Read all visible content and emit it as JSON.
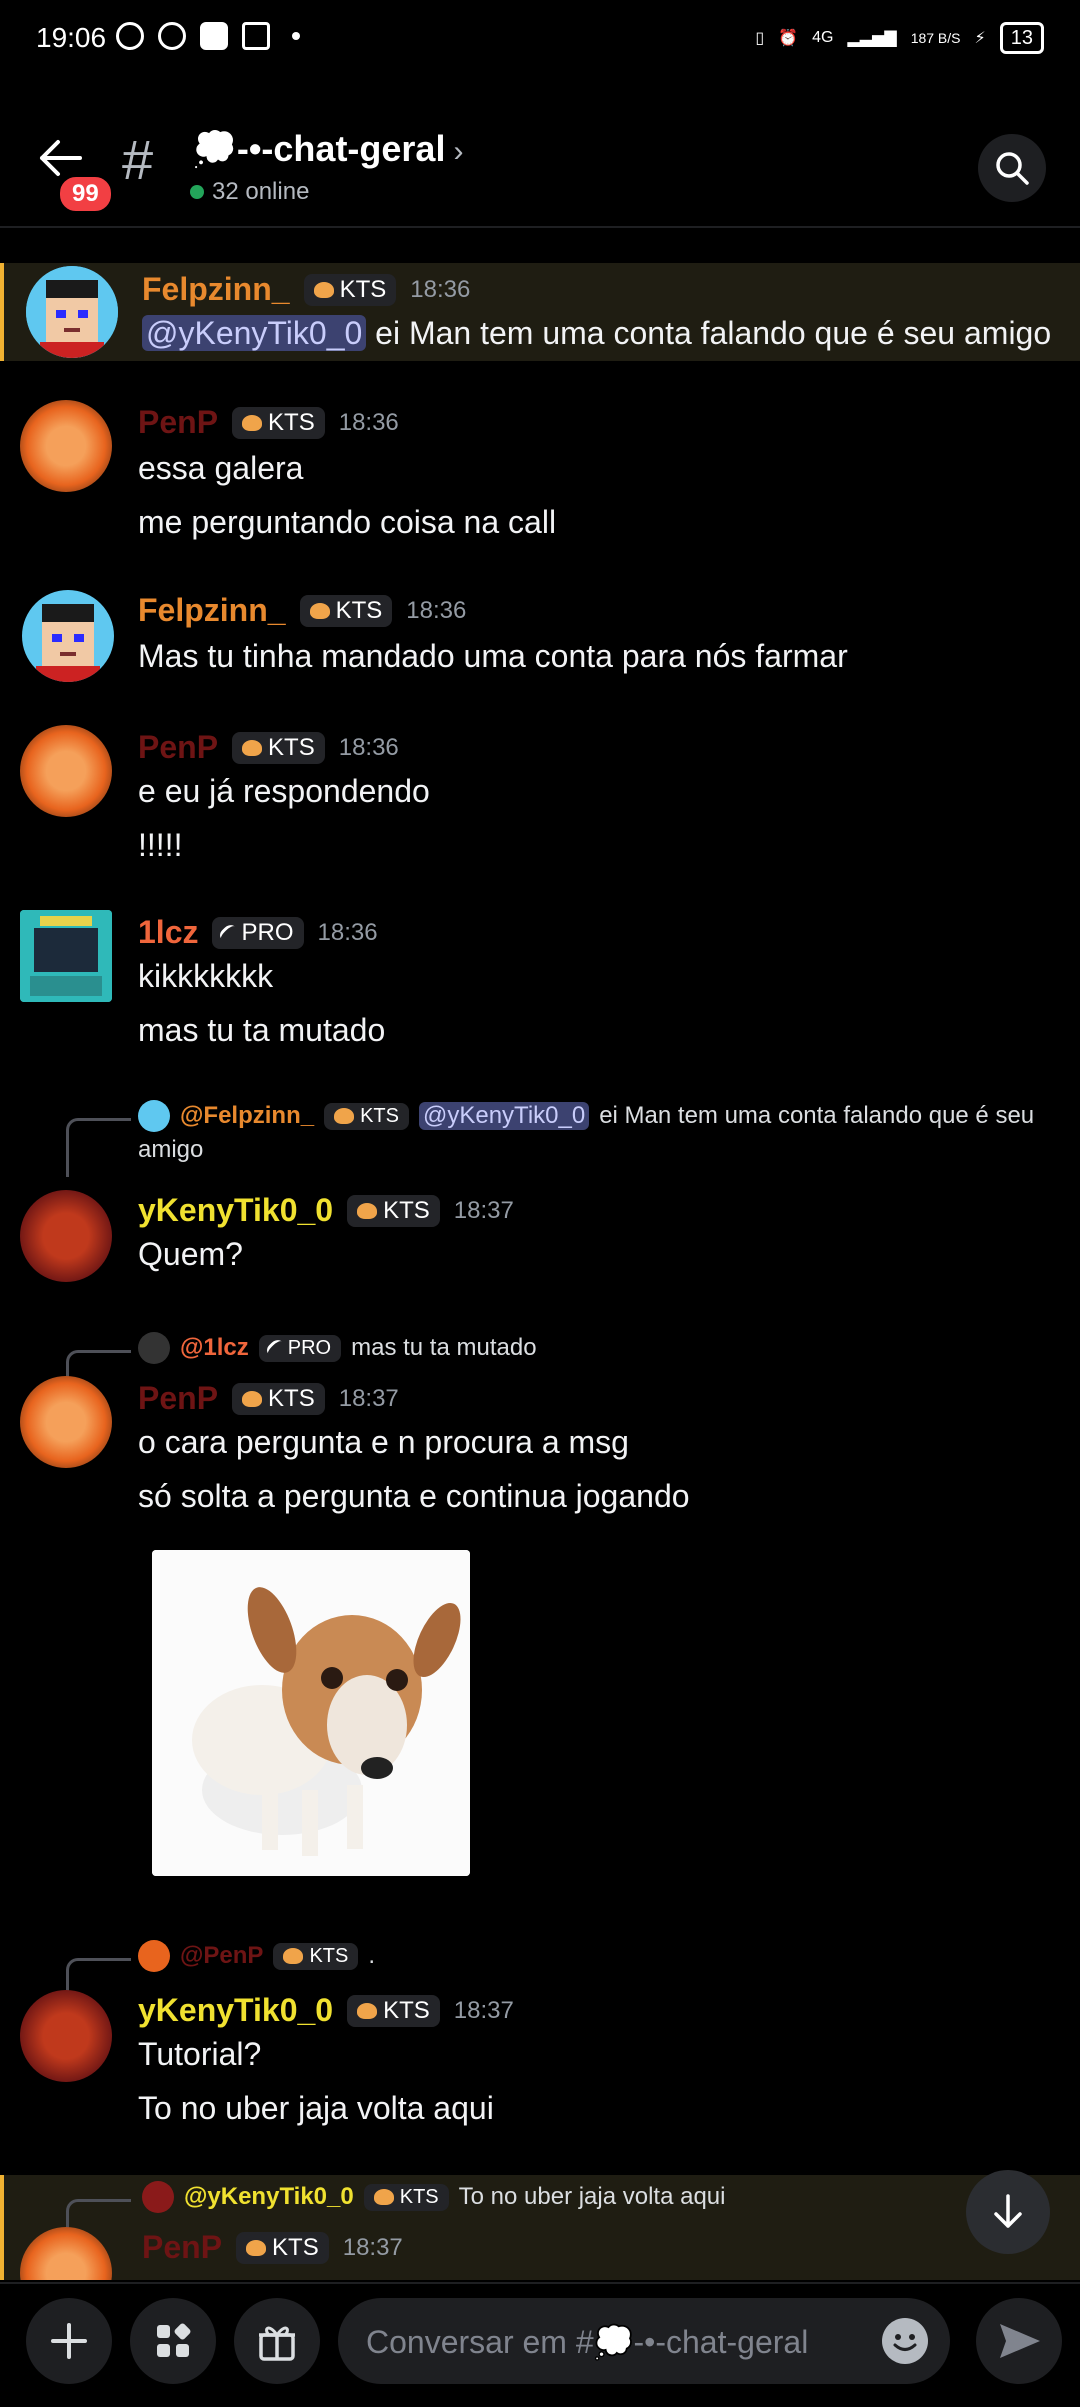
{
  "status_bar": {
    "time": "19:06",
    "network": "4G",
    "speed": "187 B/S",
    "battery": "13"
  },
  "header": {
    "badge": "99",
    "channel_name": "💭-•-chat-geral",
    "online": "32 online"
  },
  "colors": {
    "mention_bg": "#3c4270",
    "online": "#23a55a",
    "badge": "#f23f43",
    "highlight": "#f0b232"
  },
  "messages": [
    {
      "user": "Felpzinn_",
      "user_color": "#e8892e",
      "tag": "KTS",
      "time": "18:36",
      "mention": "@yKenyTik0_0",
      "text_after": " ei Man tem uma conta falando que é seu amigo"
    },
    {
      "user": "PenP",
      "user_color": "#6e1414",
      "tag": "KTS",
      "time": "18:36",
      "lines": [
        "essa galera",
        "me perguntando coisa na call"
      ]
    },
    {
      "user": "Felpzinn_",
      "user_color": "#e8892e",
      "tag": "KTS",
      "time": "18:36",
      "lines": [
        "Mas tu tinha mandado uma conta para nós farmar"
      ]
    },
    {
      "user": "PenP",
      "user_color": "#6e1414",
      "tag": "KTS",
      "time": "18:36",
      "lines": [
        "e eu já respondendo",
        "!!!!!"
      ]
    },
    {
      "user": "1lcz",
      "user_color": "#f0663c",
      "tag": "PRO",
      "time": "18:36",
      "lines": [
        "kikkkkkkk",
        "mas tu ta mutado"
      ]
    },
    {
      "reply": {
        "user": "@Felpzinn_",
        "tag": "KTS",
        "mention": "@yKenyTik0_0",
        "text": "ei Man tem uma conta falando que é seu",
        "text2": "amigo"
      },
      "user": "yKenyTik0_0",
      "user_color": "#f0e130",
      "tag": "KTS",
      "time": "18:37",
      "lines": [
        "Quem?"
      ]
    },
    {
      "reply": {
        "user": "@1lcz",
        "tag": "PRO",
        "text": "mas tu ta mutado"
      },
      "user": "PenP",
      "user_color": "#6e1414",
      "tag": "KTS",
      "time": "18:37",
      "lines": [
        "o cara pergunta e n procura a msg",
        "só solta a pergunta e continua jogando"
      ]
    },
    {
      "reply": {
        "user": "@PenP",
        "tag": "KTS",
        "text": "."
      },
      "user": "yKenyTik0_0",
      "user_color": "#f0e130",
      "tag": "KTS",
      "time": "18:37",
      "lines": [
        "Tutorial?",
        "To no uber jaja volta aqui"
      ]
    },
    {
      "reply": {
        "user": "@yKenyTik0_0",
        "tag": "KTS",
        "text": "To no uber jaja volta aqui"
      },
      "user": "PenP",
      "user_color": "#6e1414",
      "tag": "KTS",
      "time": "18:37"
    }
  ],
  "composer": {
    "placeholder": "Conversar em #💭-•-chat-geral"
  }
}
